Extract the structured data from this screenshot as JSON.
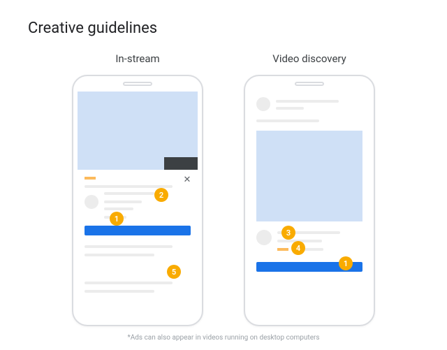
{
  "title": "Creative guidelines",
  "columns": {
    "instream": {
      "label": "In-stream"
    },
    "discovery": {
      "label": "Video discovery"
    }
  },
  "badges": {
    "b1": "1",
    "b2": "2",
    "b3": "3",
    "b4": "4",
    "b5": "5",
    "d1": "1",
    "d3": "3",
    "d4": "4"
  },
  "icons": {
    "close": "✕"
  },
  "footnote": "*Ads can also appear in videos running on desktop computers"
}
